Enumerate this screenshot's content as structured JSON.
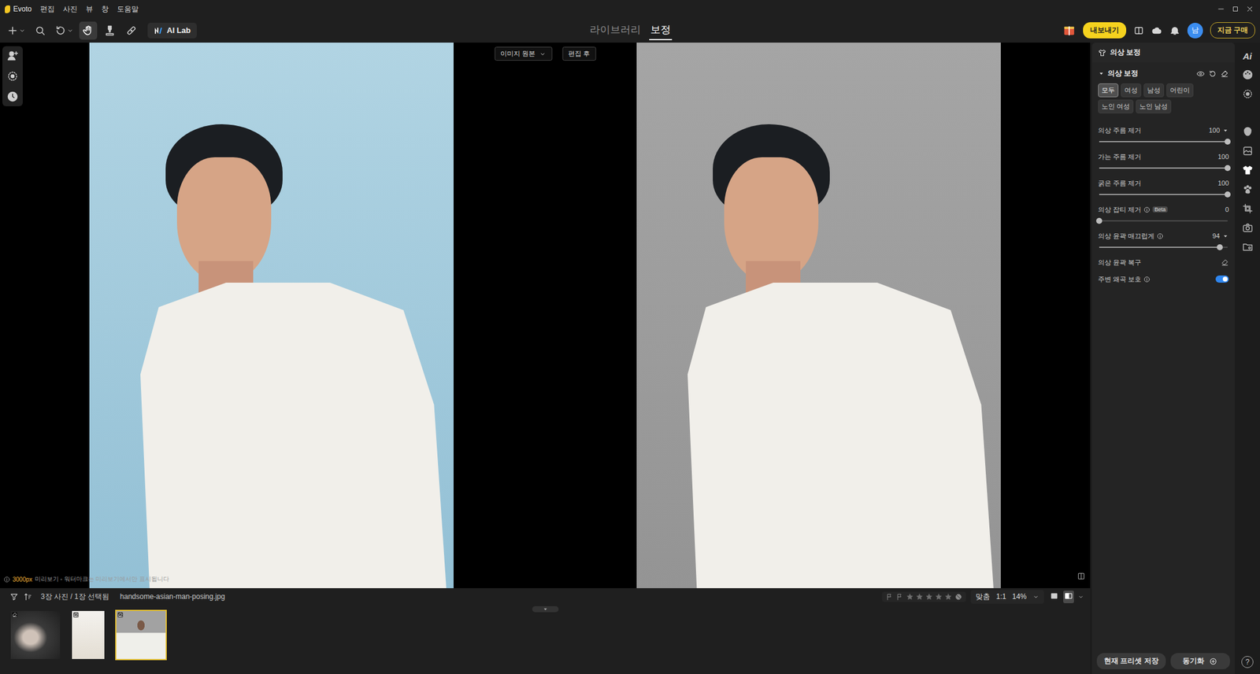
{
  "window": {
    "app": "Evoto",
    "menu": [
      {
        "label": "편집"
      },
      {
        "label": "사진"
      },
      {
        "label": "뷰"
      },
      {
        "label": "창"
      },
      {
        "label": "도움말"
      }
    ]
  },
  "toolbar": {
    "tools": [
      {
        "kind": "add",
        "selected": false
      },
      {
        "kind": "search",
        "selected": false
      },
      {
        "kind": "undo",
        "selected": false
      },
      {
        "kind": "hand",
        "selected": true
      },
      {
        "kind": "stamp",
        "selected": false
      },
      {
        "kind": "heal",
        "selected": false
      }
    ],
    "ai_lab": "AI Lab",
    "tabs": [
      {
        "label": "라이브러리",
        "selected": false
      },
      {
        "label": "보정",
        "selected": true
      }
    ],
    "export": "내보내기",
    "avatar": "남",
    "buy": "지금 구매"
  },
  "canvas": {
    "original_label": "이미지 원본",
    "after_label": "편집 후",
    "note_size": "3000px",
    "note_text": "미리보기 - 워터마크는 미리보기에서만 표시됩니다"
  },
  "panel": {
    "title": "의상 보정",
    "section": {
      "title": "의상 보정",
      "expanded": true
    },
    "chips": [
      {
        "label": "모두",
        "selected": true
      },
      {
        "label": "여성",
        "selected": false
      },
      {
        "label": "남성",
        "selected": false
      },
      {
        "label": "어린이",
        "selected": false
      },
      {
        "label": "노인 여성",
        "selected": false
      },
      {
        "label": "노인 남성",
        "selected": false
      }
    ],
    "controls": [
      {
        "kind": "slider",
        "label": "의상 주름 제거",
        "value": "100",
        "level": 1,
        "info": false,
        "menu": true
      },
      {
        "kind": "slider",
        "label": "가는 주름 제거",
        "value": "100",
        "level": 1,
        "info": false,
        "menu": false
      },
      {
        "kind": "slider",
        "label": "굵은 주름 제거",
        "value": "100",
        "level": 1,
        "info": false,
        "menu": false
      },
      {
        "kind": "slider",
        "label": "의상 잡티 제거",
        "value": "0",
        "level": 0,
        "info": true,
        "badge": "Beta",
        "menu": false
      },
      {
        "kind": "slider",
        "label": "의상 윤곽 매끄럽게",
        "value": "94",
        "level": 0.94,
        "info": true,
        "menu": true
      },
      {
        "kind": "action",
        "label": "의상 윤곽 복구"
      },
      {
        "kind": "toggle",
        "label": "주변 왜곡 보호",
        "info": true,
        "on": true
      }
    ],
    "save_preset": "현재 프리셋 저장",
    "sync": "동기화"
  },
  "side_strip": {
    "ai": "Ai",
    "items": [
      {
        "kind": "palette",
        "selected": false
      },
      {
        "kind": "texture",
        "selected": false
      },
      {
        "kind": "face",
        "selected": false
      },
      {
        "kind": "background",
        "selected": false
      },
      {
        "kind": "shirt",
        "selected": true
      },
      {
        "kind": "paw",
        "selected": false
      },
      {
        "kind": "crop",
        "selected": false
      },
      {
        "kind": "camera",
        "selected": false
      },
      {
        "kind": "folder",
        "selected": false
      }
    ]
  },
  "filmstrip": {
    "count": "3장 사진 / 1장 선택됨",
    "filename": "handsome-asian-man-posing.jpg",
    "stars": 0,
    "fit": "맞춤",
    "ratio": "1:1",
    "zoom": "14%",
    "split_view": true,
    "thumbnails": [
      {
        "selected": false,
        "edited": true
      },
      {
        "selected": false,
        "edited": true
      },
      {
        "selected": true,
        "edited": true
      }
    ]
  },
  "help": "?"
}
